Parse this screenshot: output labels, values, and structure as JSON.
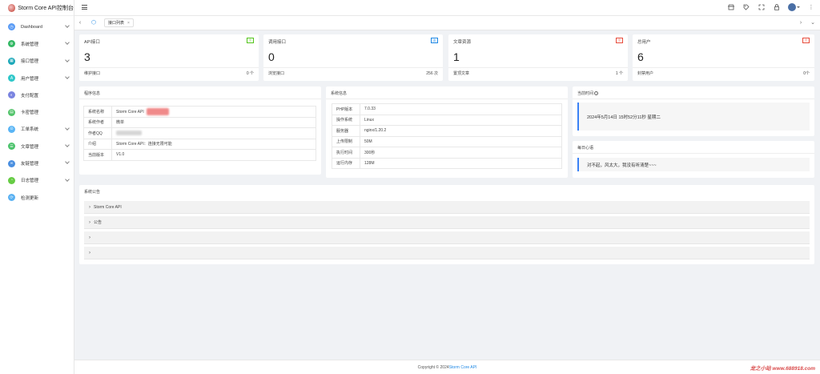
{
  "brand": {
    "title": "Storm Core API控制台"
  },
  "sidebar": {
    "items": [
      {
        "label": "Dashboard",
        "color": "#5b9cf5",
        "has_arrow": true
      },
      {
        "label": "系统管理",
        "color": "#33b864",
        "has_arrow": true
      },
      {
        "label": "接口管理",
        "color": "#1aa7b8",
        "has_arrow": true
      },
      {
        "label": "用户管理",
        "color": "#2ec7c9",
        "has_arrow": true
      },
      {
        "label": "支付配置",
        "color": "#7a84e0",
        "has_arrow": false
      },
      {
        "label": "卡密管理",
        "color": "#53c46b",
        "has_arrow": false
      },
      {
        "label": "工单系统",
        "color": "#5ab5f5",
        "has_arrow": true
      },
      {
        "label": "文章管理",
        "color": "#4cc36c",
        "has_arrow": true
      },
      {
        "label": "友链管理",
        "color": "#4a8fe0",
        "has_arrow": true
      },
      {
        "label": "日志管理",
        "color": "#66cc44",
        "has_arrow": true
      },
      {
        "label": "检测更新",
        "color": "#5ab1f2",
        "has_arrow": false
      }
    ]
  },
  "tabs": {
    "active": "接口列表"
  },
  "stats": [
    {
      "title": "API接口",
      "badge": "个",
      "badge_color": "#52c41a",
      "value": "3",
      "foot_label": "维护接口",
      "foot_value": "0 个"
    },
    {
      "title": "调用接口",
      "badge": "次",
      "badge_color": "#1e88e5",
      "value": "0",
      "foot_label": "浏览接口",
      "foot_value": "256 次"
    },
    {
      "title": "文章资源",
      "badge": "个",
      "badge_color": "#e74c3c",
      "value": "1",
      "foot_label": "置顶文章",
      "foot_value": "1 个"
    },
    {
      "title": "总用户",
      "badge": "个",
      "badge_color": "#e74c3c",
      "value": "6",
      "foot_label": "封禁用户",
      "foot_value": "0个"
    }
  ],
  "program_info": {
    "title": "程序信息",
    "rows": [
      {
        "k": "系统名称",
        "v": "Storm Core API"
      },
      {
        "k": "系统作者",
        "v": "微单"
      },
      {
        "k": "作者QQ",
        "v": ""
      },
      {
        "k": "介绍",
        "v": "Storm Core API：连接无限可能"
      },
      {
        "k": "当前版本",
        "v": "V1.0"
      }
    ]
  },
  "system_info": {
    "title": "系统信息",
    "rows": [
      {
        "k": "PHP版本",
        "v": "7.0.33"
      },
      {
        "k": "操作系统",
        "v": "Linux"
      },
      {
        "k": "服务器",
        "v": "nginx/1.20.2"
      },
      {
        "k": "上传限制",
        "v": "50M"
      },
      {
        "k": "执行时间",
        "v": "300秒"
      },
      {
        "k": "运行内存",
        "v": "128M"
      }
    ]
  },
  "current_time": {
    "title": "当前时间",
    "value": "2024年5月14日 15时52分11秒 星期二"
  },
  "daily_quote": {
    "title": "每日心语",
    "value": "对不起，风太大，我没有听清楚~~~"
  },
  "notice": {
    "title": "系统公告",
    "items": [
      "Storm Core API",
      "公告",
      "",
      ""
    ]
  },
  "footer": {
    "copyright": "Copyright © 2024",
    "link": "Storm Core API"
  },
  "watermark": "龙之小站 www.688918.com"
}
